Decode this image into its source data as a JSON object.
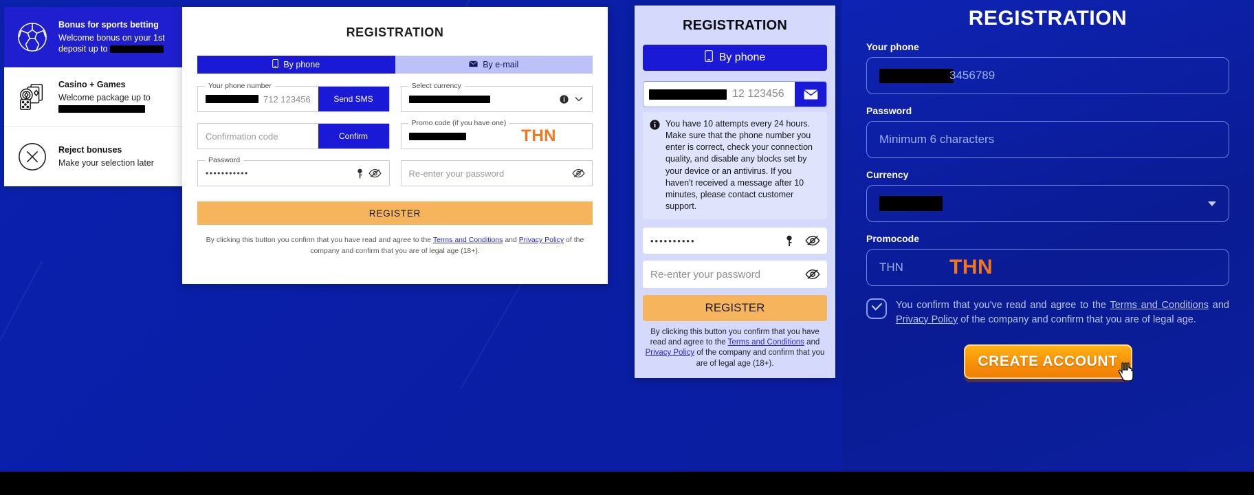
{
  "bonus_sidebar": {
    "items": [
      {
        "icon": "soccer-ball-icon",
        "title": "Bonus for sports betting",
        "subtitle_line1": "Welcome bonus on your 1st",
        "subtitle_line2": "deposit up to",
        "amount_redacted": true,
        "selected": true
      },
      {
        "icon": "casino-chips-cards-icon",
        "title": "Casino + Games",
        "subtitle_line1": "Welcome package up to",
        "subtitle_line2": "",
        "amount_redacted": true,
        "selected": false
      },
      {
        "icon": "reject-x-circle-icon",
        "title": "Reject bonuses",
        "subtitle_line1": "Make your selection later",
        "subtitle_line2": "",
        "amount_redacted": false,
        "selected": false
      }
    ]
  },
  "desktop_form": {
    "title": "REGISTRATION",
    "tabs": [
      {
        "label": "By phone",
        "icon": "mobile-phone-icon",
        "active": true
      },
      {
        "label": "By e-mail",
        "icon": "envelope-icon",
        "active": false
      }
    ],
    "phone": {
      "legend": "Your phone number",
      "country_code_redacted": true,
      "placeholder": "712 123456",
      "action_label": "Send SMS"
    },
    "currency": {
      "legend": "Select currency",
      "value_redacted": true,
      "info_icon": "info-circle-icon",
      "caret_icon": "chevron-down-icon"
    },
    "confirmation": {
      "placeholder": "Confirmation code",
      "action_label": "Confirm"
    },
    "promo": {
      "legend": "Promo code (if you have one)",
      "value_redacted": true,
      "badge": "THN"
    },
    "password": {
      "legend": "Password",
      "value_masked": "•••••••••••",
      "key_icon": "key-icon",
      "eye_icon": "eye-off-icon"
    },
    "password_repeat": {
      "placeholder": "Re-enter your password",
      "eye_icon": "eye-off-icon"
    },
    "submit_label": "REGISTER",
    "legal": {
      "part1": "By clicking this button you confirm that you have read and agree to the ",
      "link1": "Terms and Conditions",
      "part2": " and ",
      "link2": "Privacy Policy",
      "part3": " of the company and confirm that you are of legal age (18+)."
    }
  },
  "mobile_panel": {
    "title": "REGISTRATION",
    "tab_label": "By phone",
    "tab_icon": "mobile-phone-icon",
    "phone": {
      "country_code_redacted": true,
      "placeholder": "12 123456",
      "action_icon": "envelope-icon"
    },
    "note": {
      "icon": "info-circle-icon",
      "text": "You have 10 attempts every 24 hours. Make sure that the phone number you enter is correct, check your connection quality, and disable any blocks set by your device or an antivirus. If you haven't received a message after 10 minutes, please contact customer support."
    },
    "password": {
      "value_masked": "••••••••••",
      "key_icon": "key-icon",
      "eye_icon": "eye-off-icon"
    },
    "password_repeat": {
      "placeholder": "Re-enter your password",
      "eye_icon": "eye-off-icon"
    },
    "submit_label": "REGISTER",
    "legal": {
      "part1": "By clicking this button you confirm that you have read and agree to the ",
      "link1": "Terms and Conditions",
      "part2": " and ",
      "link2": "Privacy Policy",
      "part3": " of the company and confirm that you are of legal age (18+)."
    }
  },
  "right_panel": {
    "title": "REGISTRATION",
    "phone": {
      "label": "Your phone",
      "prefix_redacted": true,
      "value": "3456789"
    },
    "password": {
      "label": "Password",
      "placeholder": "Minimum 6 characters"
    },
    "currency": {
      "label": "Currency",
      "value_redacted": true,
      "caret_icon": "chevron-down-icon"
    },
    "promocode": {
      "label": "Promocode",
      "placeholder": "THN",
      "value": "THN"
    },
    "terms": {
      "checkbox_icon": "checkmark-icon",
      "checked": true,
      "part1": "You confirm that you've read and agree to the ",
      "link1": "Terms and Conditions",
      "part2": " and ",
      "link2": "Privacy Policy",
      "part3": " of the company and confirm that you are of legal age."
    },
    "cta_label": "CREATE ACCOUNT",
    "cursor_icon": "pointer-hand-cursor"
  },
  "colors": {
    "brand_blue": "#1a1ad6",
    "page_blue": "#0b1fa8",
    "accent_orange": "#f5761a",
    "button_amber": "#f6b45c",
    "cta_gold": "#f79008",
    "tab_inactive": "#bcc2f7",
    "mobile_bg": "#d5d9fb"
  }
}
